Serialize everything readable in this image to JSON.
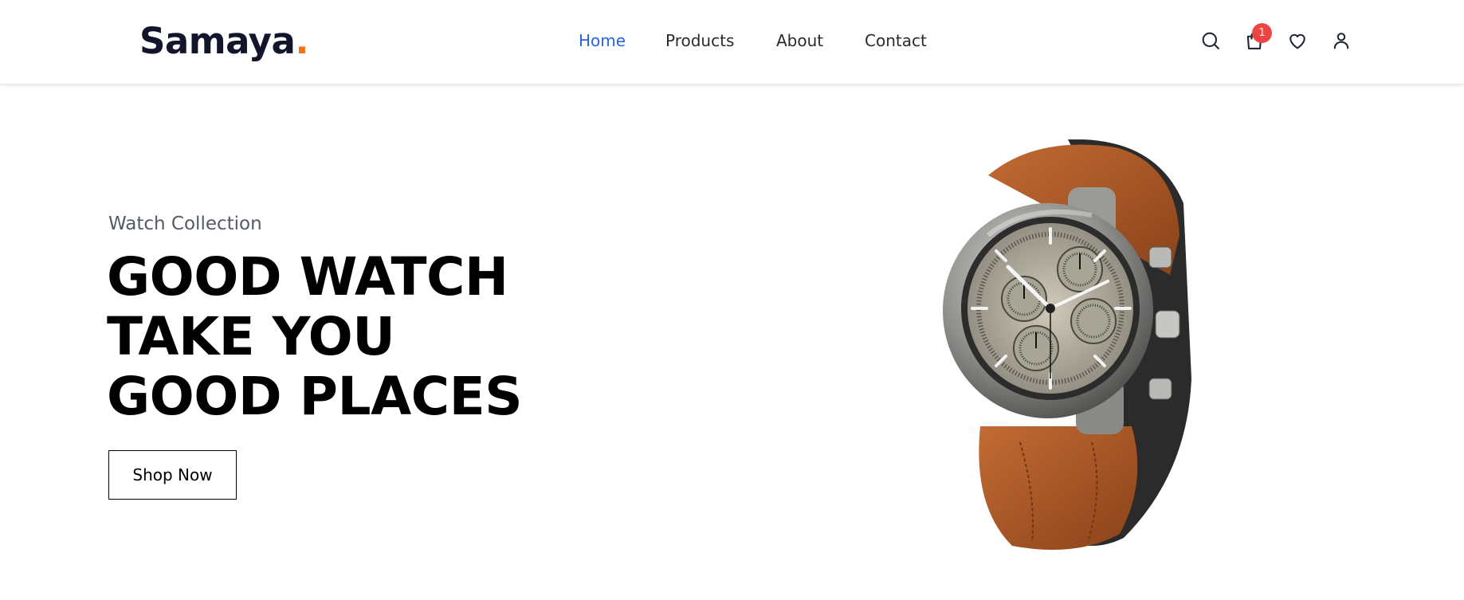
{
  "brand": {
    "name": "Samaya",
    "dot": ".",
    "accent_color": "#f97316"
  },
  "nav": {
    "items": [
      {
        "label": "Home",
        "active": true
      },
      {
        "label": "Products",
        "active": false
      },
      {
        "label": "About",
        "active": false
      },
      {
        "label": "Contact",
        "active": false
      }
    ],
    "active_color": "#2563eb"
  },
  "header_icons": {
    "search": "search-icon",
    "cart": "shopping-bag-icon",
    "cart_count": "1",
    "wishlist": "heart-icon",
    "account": "user-icon"
  },
  "hero": {
    "subtitle": "Watch Collection",
    "title_lines": [
      "GOOD WATCH",
      "TAKE YOU",
      "GOOD PLACES"
    ],
    "cta_label": "Shop Now",
    "image": "wristwatch-image"
  }
}
